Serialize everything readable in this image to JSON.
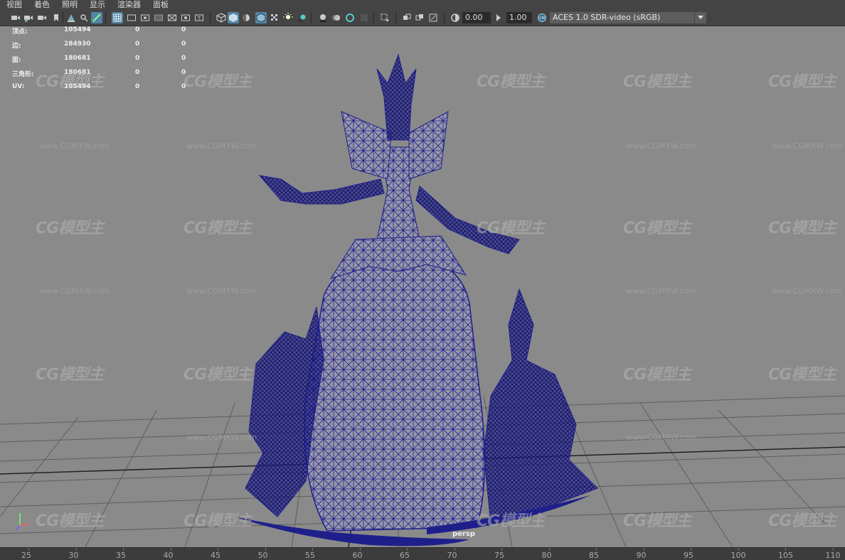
{
  "menu": [
    "视图",
    "着色",
    "照明",
    "显示",
    "渲染器",
    "面板"
  ],
  "toolbar": {
    "exposure_value": "0.00",
    "gamma_value": "1.00",
    "color_space": "ACES 1.0 SDR-video (sRGB)"
  },
  "hud": {
    "rows": [
      {
        "label": "顶点:",
        "a": "105494",
        "b": "0",
        "c": "0"
      },
      {
        "label": "边:",
        "a": "284930",
        "b": "0",
        "c": "0"
      },
      {
        "label": "面:",
        "a": "180681",
        "b": "0",
        "c": "0"
      },
      {
        "label": "三角形:",
        "a": "180681",
        "b": "0",
        "c": "0"
      },
      {
        "label": "UV:",
        "a": "105494",
        "b": "0",
        "c": "0"
      }
    ]
  },
  "viewport": {
    "camera": "persp",
    "watermark_logo": "CG模型主",
    "watermark_url": "www.CGMXW.com"
  },
  "timeline": {
    "ticks": [
      "25",
      "30",
      "35",
      "40",
      "45",
      "50",
      "55",
      "60",
      "65",
      "70",
      "75",
      "80",
      "85",
      "90",
      "95",
      "100",
      "105",
      "110"
    ]
  },
  "colors": {
    "wireframe": "#1f1f8c",
    "viewport_bg": "#8a8a8a",
    "active_button": "#5285a6"
  }
}
